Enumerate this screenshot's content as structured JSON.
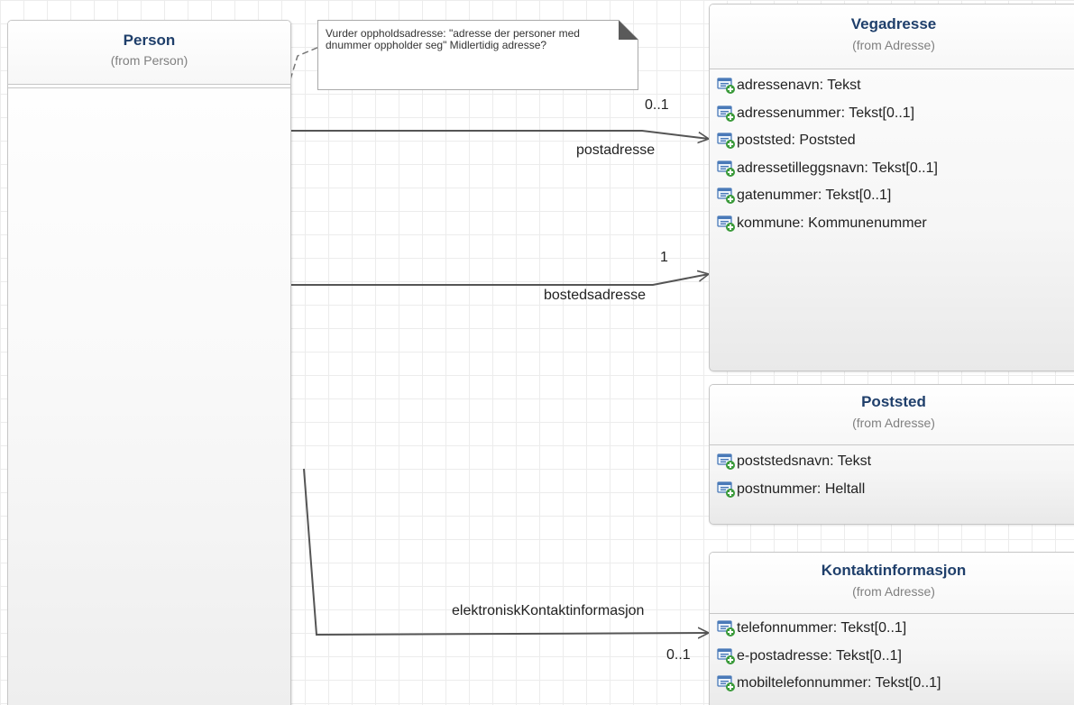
{
  "note": {
    "text": "Vurder oppholdsadresse: \"adresse der personer med dnummer oppholder seg\" Midlertidig adresse?"
  },
  "classes": {
    "person": {
      "name": "Person",
      "from": "(from Person)"
    },
    "vegadresse": {
      "name": "Vegadresse",
      "from": "(from Adresse)",
      "attributes": [
        "adressenavn: Tekst",
        "adressenummer: Tekst[0..1]",
        "poststed: Poststed",
        "adressetilleggsnavn: Tekst[0..1]",
        "gatenummer: Tekst[0..1]",
        "kommune: Kommunenummer"
      ]
    },
    "poststed": {
      "name": "Poststed",
      "from": "(from Adresse)",
      "attributes": [
        "poststedsnavn: Tekst",
        "postnummer: Heltall"
      ]
    },
    "kontaktinformasjon": {
      "name": "Kontaktinformasjon",
      "from": "(from Adresse)",
      "attributes": [
        "telefonnummer: Tekst[0..1]",
        "e-postadresse: Tekst[0..1]",
        "mobiltelefonnummer: Tekst[0..1]"
      ]
    }
  },
  "associations": {
    "postadresse": {
      "role": "postadresse",
      "multiplicity": "0..1"
    },
    "bostedsadresse": {
      "role": "bostedsadresse",
      "multiplicity": "1"
    },
    "kontakt": {
      "role": "elektroniskKontaktinformasjon",
      "multiplicity": "0..1"
    }
  },
  "icons": {
    "attribute": "attribute-public-icon"
  },
  "colors": {
    "class_name": "#1f3f6b",
    "icon_blue": "#4a7ab8",
    "icon_green": "#3a9a3a",
    "connector": "#555555"
  }
}
